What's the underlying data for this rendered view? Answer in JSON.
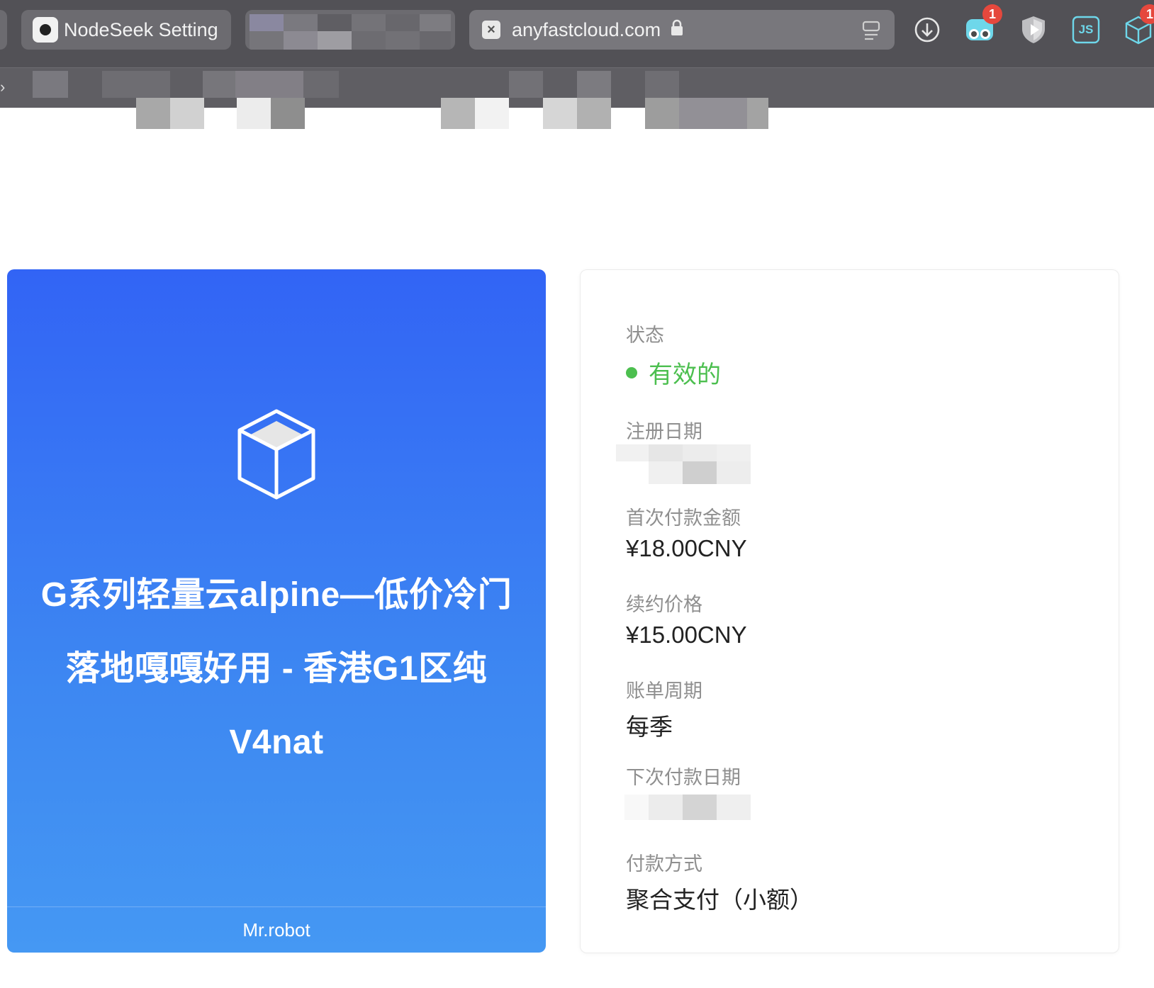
{
  "browser": {
    "tabs": [
      {
        "label": "NodeSeek Setting"
      },
      {
        "label": ""
      }
    ],
    "address_bar": {
      "url": "anyfastcloud.com"
    },
    "extension_badges": {
      "ghostery": "1",
      "cube_ext": "1"
    },
    "extension_labels": {
      "js": "JS"
    }
  },
  "product_card": {
    "title": "G系列轻量云alpine—低价冷门落地嘎嘎好用 - 香港G1区纯V4nat",
    "footer": "Mr.robot",
    "colors": {
      "gradient_top": "#3264f5",
      "gradient_bottom": "#4598f3"
    }
  },
  "details": {
    "status_label": "状态",
    "status_value": "有效的",
    "status_color": "#4cbf4f",
    "register_date_label": "注册日期",
    "first_payment_label": "首次付款金额",
    "first_payment_value": "¥18.00CNY",
    "renewal_label": "续约价格",
    "renewal_value": "¥15.00CNY",
    "billing_cycle_label": "账单周期",
    "billing_cycle_value": "每季",
    "next_due_label": "下次付款日期",
    "payment_method_label": "付款方式",
    "payment_method_value": "聚合支付（小额）"
  }
}
